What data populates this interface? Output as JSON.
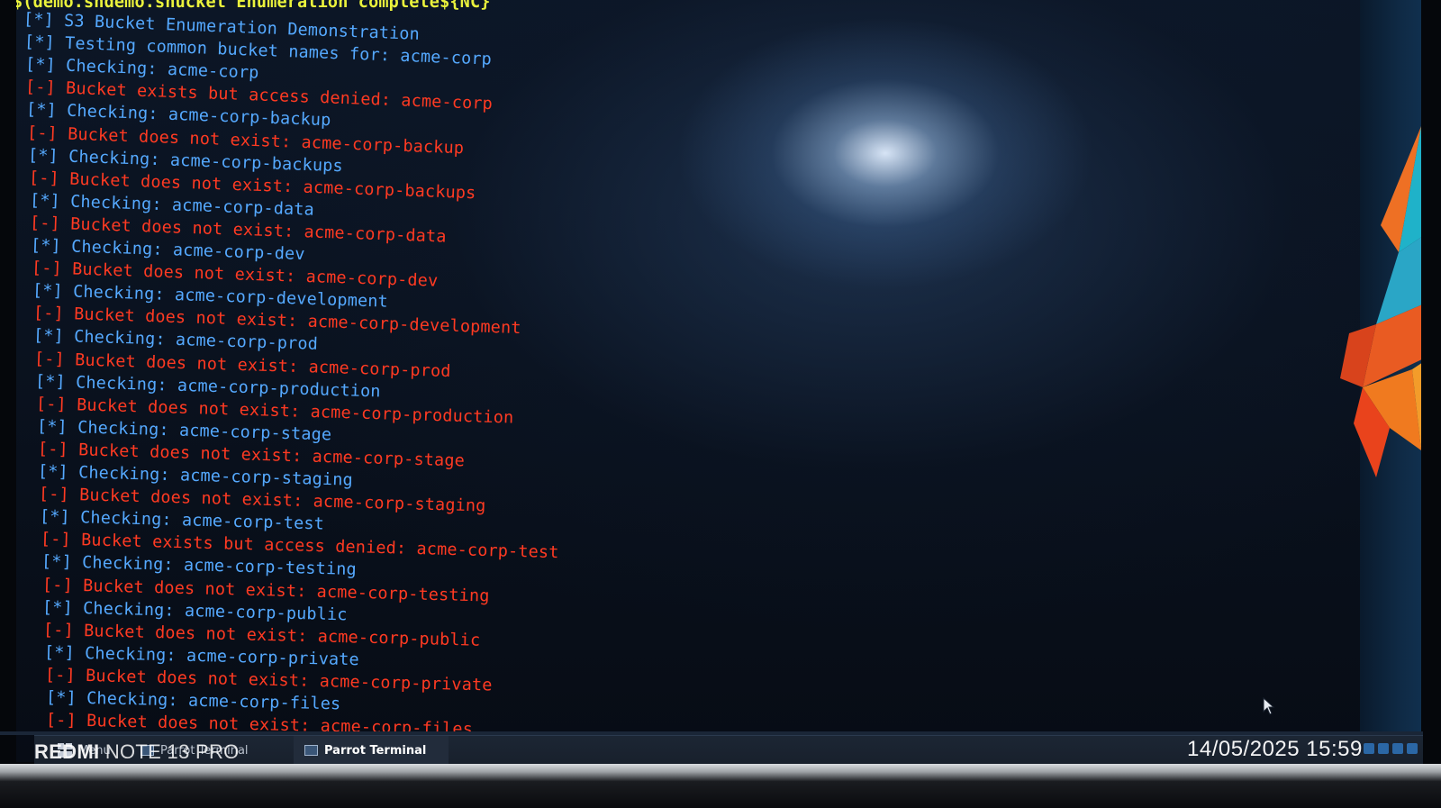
{
  "terminal": {
    "command_tail": "$(demo.shdemo.shucket Enumeration complete${NC}\"",
    "lines": [
      {
        "type": "info",
        "text": "[*] S3 Bucket Enumeration Demonstration"
      },
      {
        "type": "info",
        "text": "[*] Testing common bucket names for: acme-corp"
      },
      {
        "type": "info",
        "text": "[*] Checking: acme-corp"
      },
      {
        "type": "err",
        "text": "[-] Bucket exists but access denied: acme-corp"
      },
      {
        "type": "info",
        "text": "[*] Checking: acme-corp-backup"
      },
      {
        "type": "err",
        "text": "[-] Bucket does not exist: acme-corp-backup"
      },
      {
        "type": "info",
        "text": "[*] Checking: acme-corp-backups"
      },
      {
        "type": "err",
        "text": "[-] Bucket does not exist: acme-corp-backups"
      },
      {
        "type": "info",
        "text": "[*] Checking: acme-corp-data"
      },
      {
        "type": "err",
        "text": "[-] Bucket does not exist: acme-corp-data"
      },
      {
        "type": "info",
        "text": "[*] Checking: acme-corp-dev"
      },
      {
        "type": "err",
        "text": "[-] Bucket does not exist: acme-corp-dev"
      },
      {
        "type": "info",
        "text": "[*] Checking: acme-corp-development"
      },
      {
        "type": "err",
        "text": "[-] Bucket does not exist: acme-corp-development"
      },
      {
        "type": "info",
        "text": "[*] Checking: acme-corp-prod"
      },
      {
        "type": "err",
        "text": "[-] Bucket does not exist: acme-corp-prod"
      },
      {
        "type": "info",
        "text": "[*] Checking: acme-corp-production"
      },
      {
        "type": "err",
        "text": "[-] Bucket does not exist: acme-corp-production"
      },
      {
        "type": "info",
        "text": "[*] Checking: acme-corp-stage"
      },
      {
        "type": "err",
        "text": "[-] Bucket does not exist: acme-corp-stage"
      },
      {
        "type": "info",
        "text": "[*] Checking: acme-corp-staging"
      },
      {
        "type": "err",
        "text": "[-] Bucket does not exist: acme-corp-staging"
      },
      {
        "type": "info",
        "text": "[*] Checking: acme-corp-test"
      },
      {
        "type": "err",
        "text": "[-] Bucket exists but access denied: acme-corp-test"
      },
      {
        "type": "info",
        "text": "[*] Checking: acme-corp-testing"
      },
      {
        "type": "err",
        "text": "[-] Bucket does not exist: acme-corp-testing"
      },
      {
        "type": "info",
        "text": "[*] Checking: acme-corp-public"
      },
      {
        "type": "err",
        "text": "[-] Bucket does not exist: acme-corp-public"
      },
      {
        "type": "info",
        "text": "[*] Checking: acme-corp-private"
      },
      {
        "type": "err",
        "text": "[-] Bucket does not exist: acme-corp-private"
      },
      {
        "type": "info",
        "text": "[*] Checking: acme-corp-files"
      },
      {
        "type": "err",
        "text": "[-] Bucket does not exist: acme-corp-files"
      }
    ]
  },
  "taskbar": {
    "menu_label": "Menu",
    "tasks": [
      {
        "label": "Parrot Terminal",
        "active": false
      },
      {
        "label": "Parrot Terminal",
        "active": true
      }
    ]
  },
  "watermark": {
    "brand": "REDMI",
    "model": "NOTE 13 PRO"
  },
  "photo_timestamp": "14/05/2025 15:59",
  "colors": {
    "info": "#55a9ff",
    "error": "#ff3a22",
    "command": "#eaf23c",
    "terminal_bg": "#0a121f"
  }
}
